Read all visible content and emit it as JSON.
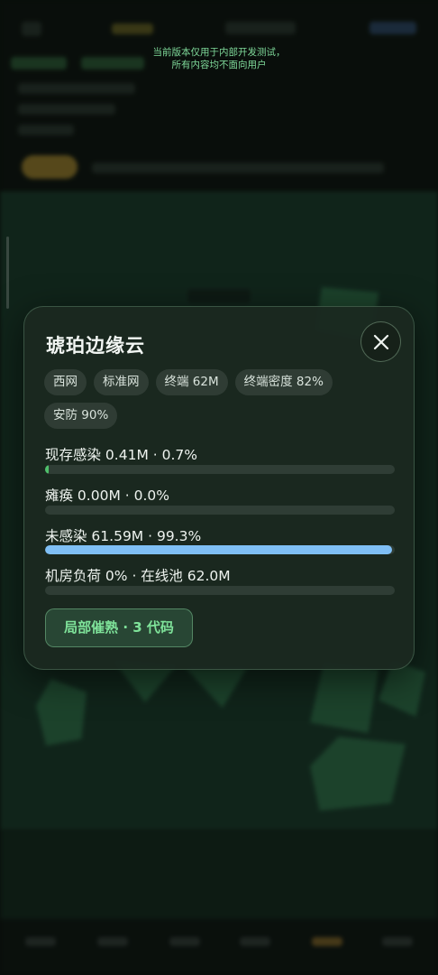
{
  "banner": {
    "line1": "当前版本仅用于内部开发测试，",
    "line2": "所有内容均不面向用户"
  },
  "dialog": {
    "title": "琥珀边缘云",
    "tags": [
      "西网",
      "标准网",
      "终端 62M",
      "终端密度 82%",
      "安防 90%"
    ],
    "stats": [
      {
        "label": "现存感染 0.41M · 0.7%",
        "progress": 0.007,
        "color": "#4fc06b"
      },
      {
        "label": "瘫痪 0.00M · 0.0%",
        "progress": 0.0,
        "color": "#4fc06b"
      },
      {
        "label": "未感染 61.59M · 99.3%",
        "progress": 0.993,
        "color": "#7fbff5"
      },
      {
        "label": "机房负荷 0% · 在线池 62.0M",
        "progress": 0.0,
        "color": "#4fc06b"
      }
    ],
    "action_label": "局部催熟 · 3 代码",
    "close_icon": "close-icon"
  }
}
